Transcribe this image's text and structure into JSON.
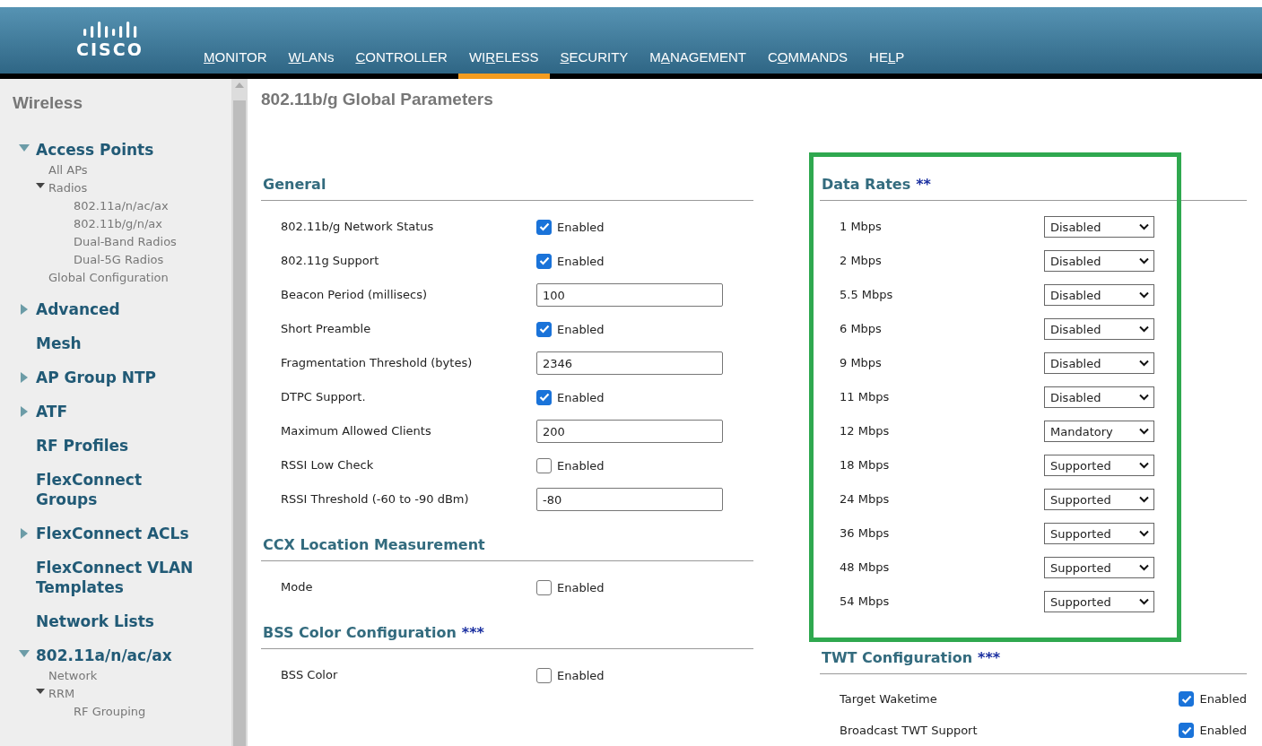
{
  "header": {
    "logo_text": "CISCO",
    "nav": [
      {
        "access_key": "M",
        "after": "ONITOR",
        "selected": false
      },
      {
        "access_key": "W",
        "after": "LANs",
        "selected": false
      },
      {
        "access_key": "C",
        "after": "ONTROLLER",
        "selected": false
      },
      {
        "before": "WI",
        "access_key": "R",
        "after": "ELESS",
        "selected": true
      },
      {
        "access_key": "S",
        "after": "ECURITY",
        "selected": false
      },
      {
        "before": "M",
        "access_key": "A",
        "after": "NAGEMENT",
        "selected": false
      },
      {
        "before": "C",
        "access_key": "O",
        "after": "MMANDS",
        "selected": false
      },
      {
        "before": "HE",
        "access_key": "L",
        "after": "P",
        "selected": false
      }
    ]
  },
  "sidebar": {
    "title": "Wireless",
    "items": [
      {
        "label": "Access Points",
        "expanded": true,
        "children": [
          {
            "label": "All APs"
          },
          {
            "label": "Radios",
            "expanded": true,
            "children": [
              {
                "label": "802.11a/n/ac/ax"
              },
              {
                "label": "802.11b/g/n/ax"
              },
              {
                "label": "Dual-Band Radios"
              },
              {
                "label": "Dual-5G Radios"
              }
            ]
          },
          {
            "label": "Global Configuration"
          }
        ]
      },
      {
        "label": "Advanced",
        "expanded": false
      },
      {
        "label": "Mesh"
      },
      {
        "label": "AP Group NTP",
        "expanded": false
      },
      {
        "label": "ATF",
        "expanded": false
      },
      {
        "label": "RF Profiles"
      },
      {
        "label": "FlexConnect Groups"
      },
      {
        "label": "FlexConnect ACLs",
        "expanded": false
      },
      {
        "label": "FlexConnect VLAN Templates"
      },
      {
        "label": "Network Lists"
      },
      {
        "label": "802.11a/n/ac/ax",
        "expanded": true,
        "children": [
          {
            "label": "Network"
          },
          {
            "label": "RRM",
            "expanded": true,
            "children": [
              {
                "label": "RF Grouping"
              }
            ]
          }
        ]
      }
    ]
  },
  "page_title": "802.11b/g Global Parameters",
  "left_sections": [
    {
      "title": "General",
      "highlighted": false,
      "rows": [
        {
          "kind": "checkbox",
          "label": "802.11b/g Network Status",
          "checked": true,
          "text": "Enabled"
        },
        {
          "kind": "checkbox",
          "label": "802.11g Support",
          "checked": true,
          "text": "Enabled"
        },
        {
          "kind": "input",
          "label": "Beacon Period (millisecs)",
          "value": "100"
        },
        {
          "kind": "checkbox",
          "label": "Short Preamble",
          "checked": true,
          "text": "Enabled"
        },
        {
          "kind": "input",
          "label": "Fragmentation Threshold (bytes)",
          "value": "2346"
        },
        {
          "kind": "checkbox",
          "label": "DTPC Support.",
          "checked": true,
          "text": "Enabled"
        },
        {
          "kind": "input",
          "label": "Maximum Allowed Clients",
          "value": "200"
        },
        {
          "kind": "checkbox",
          "label": "RSSI Low Check",
          "checked": false,
          "text": "Enabled"
        },
        {
          "kind": "input",
          "label": "RSSI Threshold (-60 to -90 dBm)",
          "value": "-80"
        }
      ]
    },
    {
      "title": "CCX Location Measurement",
      "highlighted": false,
      "rows": [
        {
          "kind": "checkbox",
          "label": "Mode",
          "checked": false,
          "text": "Enabled"
        }
      ]
    },
    {
      "title": "BSS Color Configuration",
      "marker": "***",
      "highlighted": false,
      "rows": [
        {
          "kind": "checkbox",
          "label": "BSS Color",
          "checked": false,
          "text": "Enabled"
        }
      ]
    }
  ],
  "right_sections": [
    {
      "title": "Data Rates",
      "marker": "**",
      "highlighted": true,
      "rows": [
        {
          "kind": "select",
          "label": "1 Mbps",
          "value": "Disabled"
        },
        {
          "kind": "select",
          "label": "2 Mbps",
          "value": "Disabled"
        },
        {
          "kind": "select",
          "label": "5.5 Mbps",
          "value": "Disabled"
        },
        {
          "kind": "select",
          "label": "6 Mbps",
          "value": "Disabled"
        },
        {
          "kind": "select",
          "label": "9 Mbps",
          "value": "Disabled"
        },
        {
          "kind": "select",
          "label": "11 Mbps",
          "value": "Disabled"
        },
        {
          "kind": "select",
          "label": "12 Mbps",
          "value": "Mandatory"
        },
        {
          "kind": "select",
          "label": "18 Mbps",
          "value": "Supported"
        },
        {
          "kind": "select",
          "label": "24 Mbps",
          "value": "Supported"
        },
        {
          "kind": "select",
          "label": "36 Mbps",
          "value": "Supported"
        },
        {
          "kind": "select",
          "label": "48 Mbps",
          "value": "Supported"
        },
        {
          "kind": "select",
          "label": "54 Mbps",
          "value": "Supported"
        }
      ]
    },
    {
      "title": "TWT Configuration",
      "marker": "***",
      "highlighted": false,
      "rows": [
        {
          "kind": "checkbox",
          "label": "Target Waketime",
          "checked": true,
          "text": "Enabled"
        },
        {
          "kind": "checkbox",
          "label": "Broadcast TWT Support",
          "checked": true,
          "text": "Enabled"
        }
      ]
    }
  ]
}
